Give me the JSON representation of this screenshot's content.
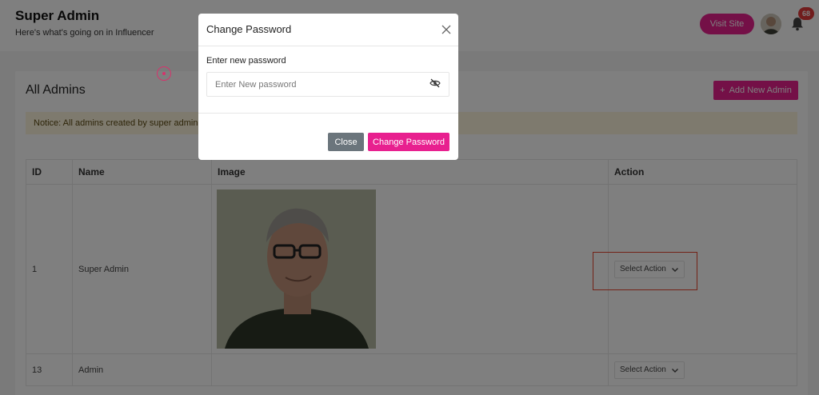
{
  "header": {
    "title": "Super Admin",
    "subtitle": "Here's what's going on in Influencer",
    "visit_site_label": "Visit Site",
    "notification_count": "68",
    "avatar_icon": "user-avatar",
    "bell_icon": "bell-icon"
  },
  "page": {
    "card_title": "All Admins",
    "add_button_label": "Add New Admin",
    "notice": "Notice: All admins created by super admin."
  },
  "table": {
    "columns": [
      "ID",
      "Name",
      "Image",
      "Action"
    ],
    "rows": [
      {
        "id": "1",
        "name": "Super Admin",
        "action": "Select Action"
      },
      {
        "id": "13",
        "name": "Admin",
        "action": "Select Action"
      }
    ]
  },
  "modal": {
    "title": "Change Password",
    "field_label": "Enter new password",
    "placeholder": "Enter New password",
    "close_label": "Close",
    "submit_label": "Change Password"
  },
  "colors": {
    "accent": "#e8208f",
    "secondary_button": "#6b757c",
    "notice_bg": "#fdf4dc",
    "badge": "#e23b3b",
    "highlight_box": "#e7452e"
  }
}
